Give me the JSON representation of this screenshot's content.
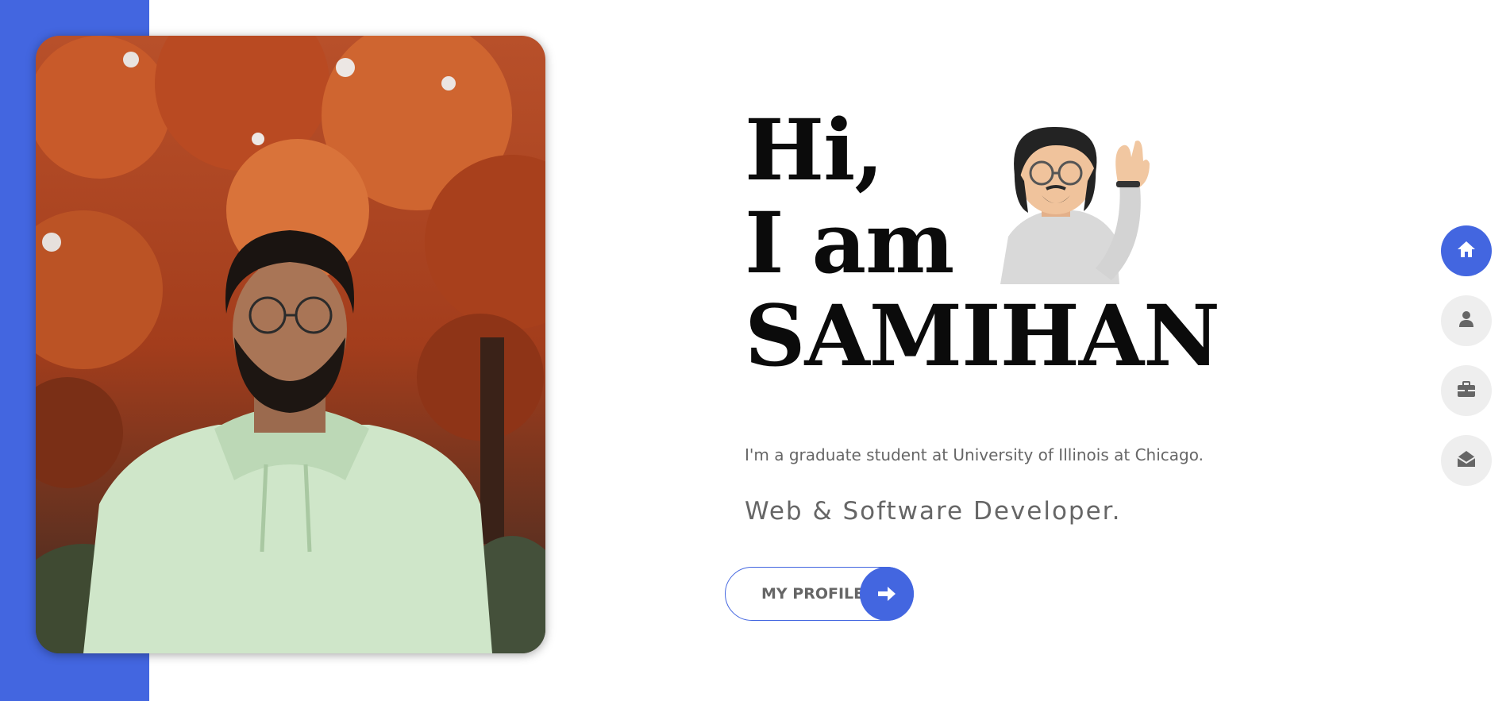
{
  "hero": {
    "greeting_line1": "Hi,",
    "greeting_line2": "I am",
    "name": "SAMIHAN",
    "subtitle": "I'm a graduate student at University of Illinois at Chicago.",
    "role": "Web & Software Developer."
  },
  "cta": {
    "label": "MY PROFILE",
    "icon": "arrow-right-icon"
  },
  "side_nav": [
    {
      "name": "home",
      "icon": "home-icon",
      "active": true
    },
    {
      "name": "about",
      "icon": "user-icon",
      "active": false
    },
    {
      "name": "portfolio",
      "icon": "briefcase-icon",
      "active": false
    },
    {
      "name": "contact",
      "icon": "envelope-open-icon",
      "active": false
    }
  ],
  "colors": {
    "accent": "#4366e0",
    "heading": "#0b0b0b",
    "body_text": "#666666",
    "nav_inactive": "#eeeeee"
  }
}
